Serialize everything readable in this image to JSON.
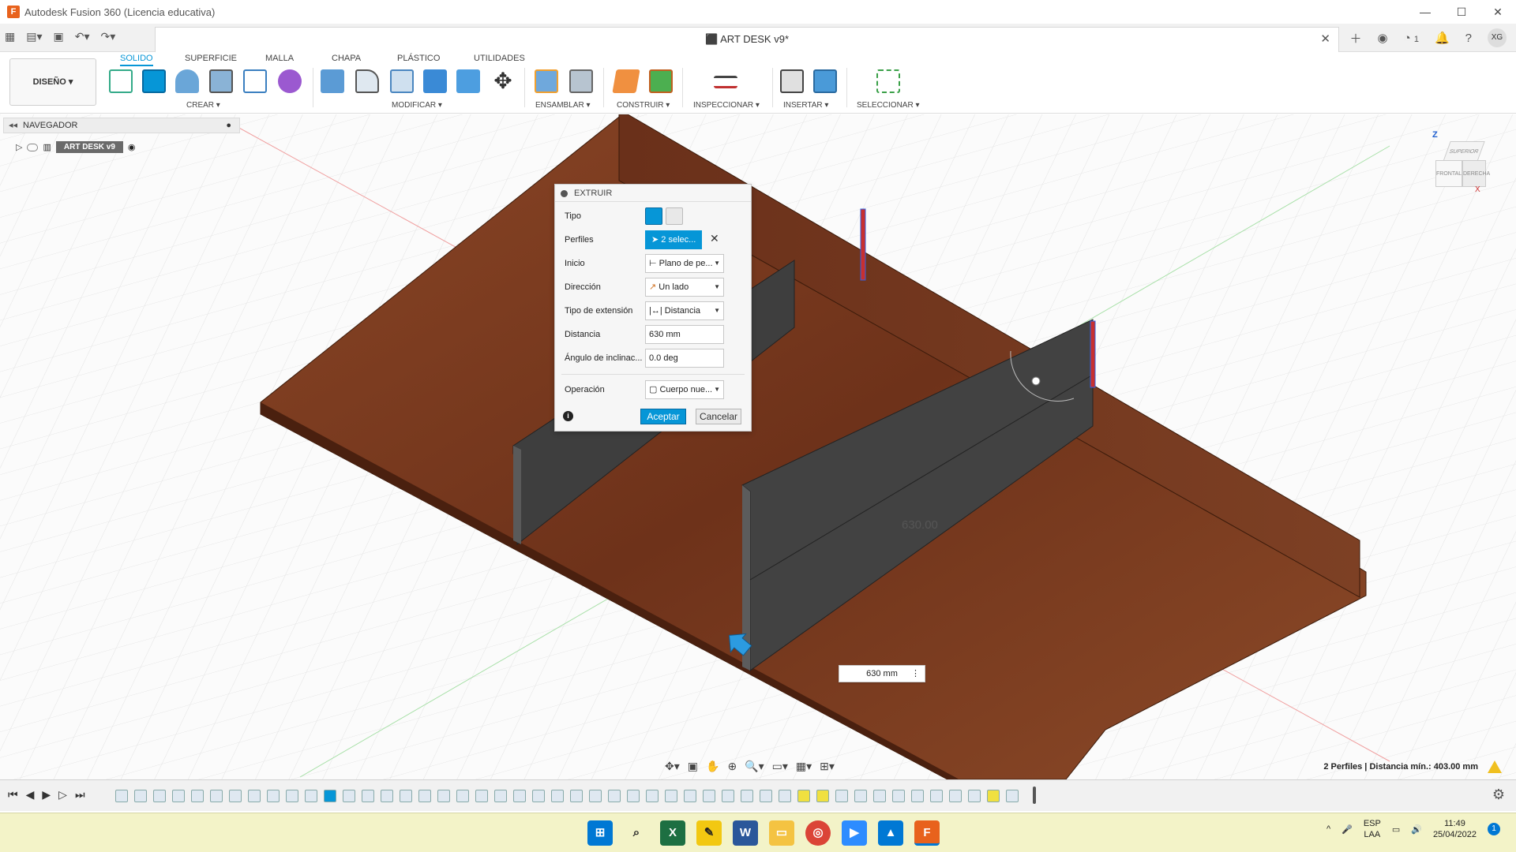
{
  "window": {
    "title": "Autodesk Fusion 360 (Licencia educativa)",
    "minimize": "—",
    "maximize": "☐",
    "close": "✕"
  },
  "doc": {
    "title": "ART DESK v9*",
    "close": "✕",
    "jobs": "1",
    "user_initials": "XG"
  },
  "workspace": {
    "label": "DISEÑO ▾"
  },
  "ribbon_tabs": [
    "SOLIDO",
    "SUPERFICIE",
    "MALLA",
    "CHAPA",
    "PLÁSTICO",
    "UTILIDADES"
  ],
  "ribbon_groups": {
    "crear": "CREAR ▾",
    "modificar": "MODIFICAR ▾",
    "ensamblar": "ENSAMBLAR ▾",
    "construir": "CONSTRUIR ▾",
    "inspeccionar": "INSPECCIONAR ▾",
    "insertar": "INSERTAR ▾",
    "seleccionar": "SELECCIONAR ▾"
  },
  "navigator": {
    "title": "NAVEGADOR",
    "node": "ART DESK v9"
  },
  "extrude_dialog": {
    "title": "EXTRUIR",
    "labels": {
      "tipo": "Tipo",
      "perfiles": "Perfiles",
      "inicio": "Inicio",
      "direccion": "Dirección",
      "tipo_extension": "Tipo de extensión",
      "distancia": "Distancia",
      "angulo": "Ángulo de inclinac...",
      "operacion": "Operación"
    },
    "perfiles_value": "2 selec...",
    "inicio_value": "Plano de pe...",
    "direccion_value": "Un lado",
    "tipo_extension_value": "Distancia",
    "distancia_value": "630 mm",
    "angulo_value": "0.0 deg",
    "operacion_value": "Cuerpo nue...",
    "accept": "Aceptar",
    "cancel": "Cancelar"
  },
  "viewport": {
    "dimension_input": "630 mm",
    "dimension_text": "630.00"
  },
  "viewcube": {
    "top": "SUPERIOR",
    "front": "FRONTAL",
    "right": "DERECHA",
    "axis_z": "Z",
    "axis_x": "X"
  },
  "status": {
    "message": "2 Perfiles | Distancia mín.: 403.00 mm"
  },
  "taskbar": {
    "lang1": "ESP",
    "lang2": "LAA",
    "time": "11:49",
    "date": "25/04/2022",
    "notifications": "1"
  },
  "colors": {
    "accent": "#0696d7",
    "wood": "#7a3a1e",
    "fusion_orange": "#e8621c"
  }
}
